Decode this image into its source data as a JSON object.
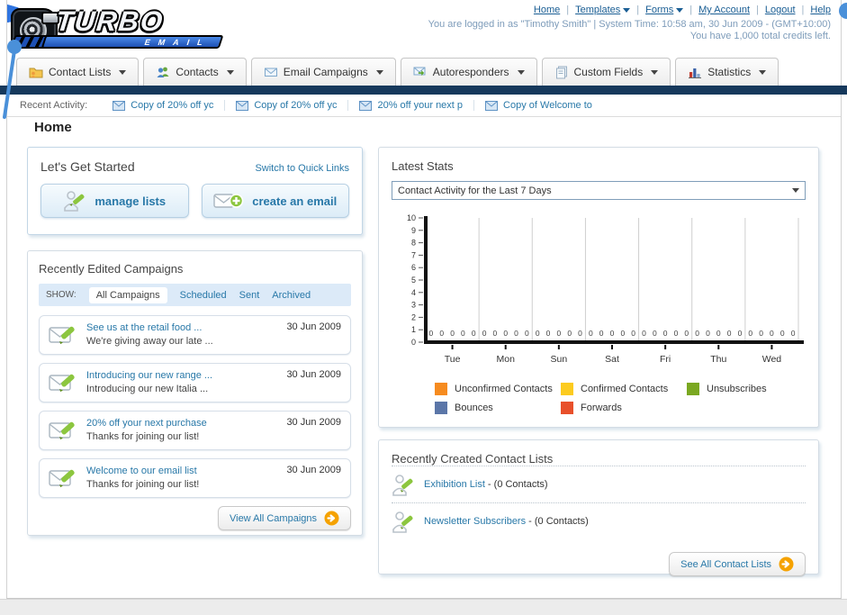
{
  "page": {
    "title": "Home"
  },
  "header": {
    "logo_title": "TURBO",
    "logo_subtitle": "EMAIL",
    "links": [
      {
        "label": "Home",
        "dropdown": false
      },
      {
        "label": "Templates",
        "dropdown": true
      },
      {
        "label": "Forms",
        "dropdown": true
      },
      {
        "label": "My Account",
        "dropdown": false
      },
      {
        "label": "Logout",
        "dropdown": false
      },
      {
        "label": "Help",
        "dropdown": false
      }
    ],
    "session_line": "You are logged in as \"Timothy Smith\" | System Time: 10:58 am, 30 Jun 2009 - (GMT+10:00)",
    "credits_line": "You have 1,000 total credits left."
  },
  "nav": {
    "tabs": [
      {
        "label": "Contact Lists",
        "icon": "contact-lists-icon"
      },
      {
        "label": "Contacts",
        "icon": "contacts-icon"
      },
      {
        "label": "Email Campaigns",
        "icon": "email-campaigns-icon"
      },
      {
        "label": "Autoresponders",
        "icon": "autoresponders-icon"
      },
      {
        "label": "Custom Fields",
        "icon": "custom-fields-icon"
      },
      {
        "label": "Statistics",
        "icon": "statistics-icon"
      }
    ]
  },
  "recent_activity": {
    "label": "Recent Activity:",
    "items": [
      {
        "label": "Copy of 20% off yc"
      },
      {
        "label": "Copy of 20% off yc"
      },
      {
        "label": "20% off your next p"
      },
      {
        "label": "Copy of Welcome to"
      }
    ]
  },
  "get_started": {
    "title": "Let's Get Started",
    "switch_link": "Switch to Quick Links",
    "manage_lists_label": "manage lists",
    "create_email_label": "create an email"
  },
  "campaigns": {
    "title": "Recently Edited Campaigns",
    "show_label": "SHOW:",
    "filters": [
      {
        "label": "All Campaigns",
        "active": true
      },
      {
        "label": "Scheduled",
        "active": false
      },
      {
        "label": "Sent",
        "active": false
      },
      {
        "label": "Archived",
        "active": false
      }
    ],
    "items": [
      {
        "title": "See us at the retail food ...",
        "subtitle": "We're giving away our late ...",
        "date": "30 Jun 2009"
      },
      {
        "title": "Introducing our new range ...",
        "subtitle": "Introducing our new Italia ...",
        "date": "30 Jun 2009"
      },
      {
        "title": "20% off your next purchase",
        "subtitle": "Thanks for joining our list!",
        "date": "30 Jun 2009"
      },
      {
        "title": "Welcome to our email list",
        "subtitle": "Thanks for joining our list!",
        "date": "30 Jun 2009"
      }
    ],
    "view_all_label": "View All Campaigns"
  },
  "stats": {
    "title": "Latest Stats",
    "selected_option": "Contact Activity for the Last 7 Days"
  },
  "contact_lists": {
    "title": "Recently Created Contact Lists",
    "items": [
      {
        "name": "Exhibition List",
        "suffix": " - (0 Contacts)"
      },
      {
        "name": "Newsletter Subscribers",
        "suffix": " - (0 Contacts)"
      }
    ],
    "see_all_label": "See All Contact Lists"
  },
  "chart_data": {
    "type": "bar",
    "title": "Contact Activity for the Last 7 Days",
    "categories": [
      "Tue",
      "Mon",
      "Sun",
      "Sat",
      "Fri",
      "Thu",
      "Wed"
    ],
    "series": [
      {
        "name": "Unconfirmed Contacts",
        "color": "#F68B1F",
        "values": [
          0,
          0,
          0,
          0,
          0,
          0,
          0
        ]
      },
      {
        "name": "Confirmed Contacts",
        "color": "#FCCB1F",
        "values": [
          0,
          0,
          0,
          0,
          0,
          0,
          0
        ]
      },
      {
        "name": "Unsubscribes",
        "color": "#7AA821",
        "values": [
          0,
          0,
          0,
          0,
          0,
          0,
          0
        ]
      },
      {
        "name": "Bounces",
        "color": "#5B76A8",
        "values": [
          0,
          0,
          0,
          0,
          0,
          0,
          0
        ]
      },
      {
        "name": "Forwards",
        "color": "#E8502B",
        "values": [
          0,
          0,
          0,
          0,
          0,
          0,
          0
        ]
      }
    ],
    "ylim": [
      0,
      10
    ],
    "y_tick_step": 1,
    "grid": "vertical",
    "legend_position": "bottom",
    "value_labels_shown": true
  }
}
